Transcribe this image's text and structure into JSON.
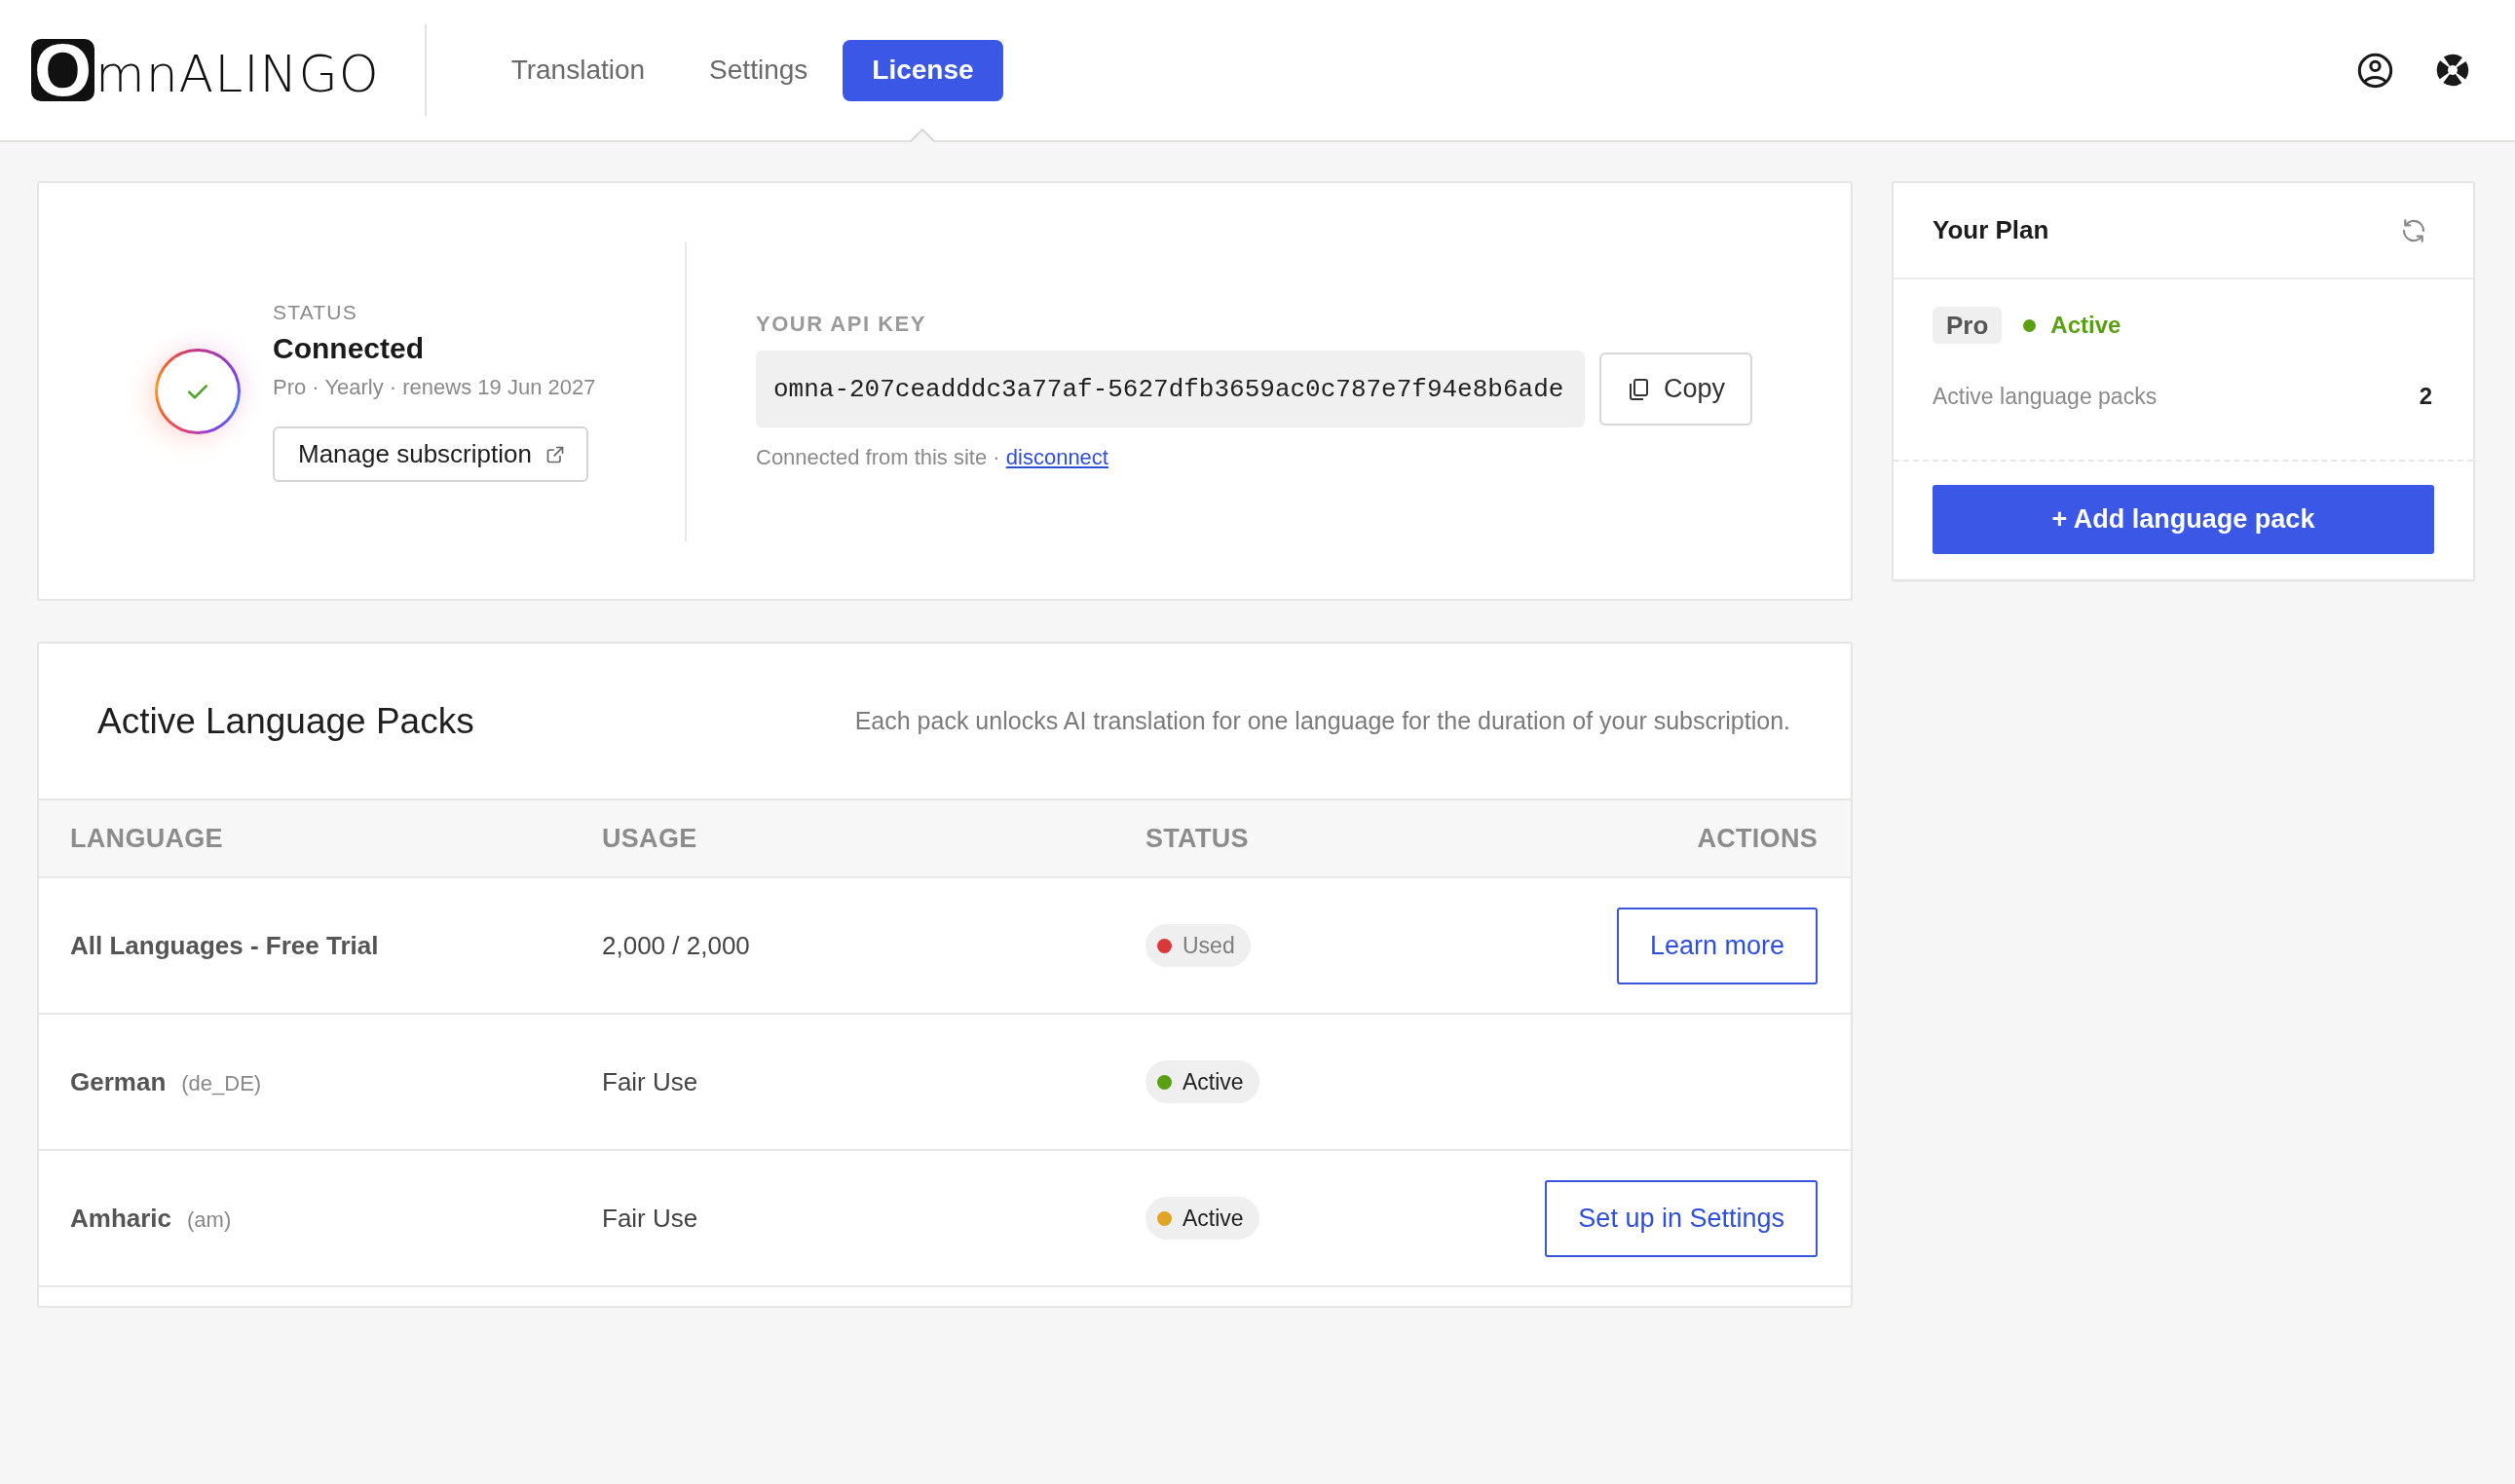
{
  "header": {
    "logo": {
      "mark": "O",
      "text": "mnALINGO"
    },
    "tabs": [
      {
        "label": "Translation",
        "selected": false
      },
      {
        "label": "Settings",
        "selected": false
      },
      {
        "label": "License",
        "selected": true
      }
    ]
  },
  "connection": {
    "status_label": "STATUS",
    "status": "Connected",
    "plan_line": "Pro · Yearly · renews 19 Jun 2027",
    "manage_button": "Manage subscription",
    "api_key_label": "YOUR API KEY",
    "api_key": "omna-207ceadddc3a77af-5627dfb3659ac0c787e7f94e8b6ade",
    "copy_button": "Copy",
    "note": "Connected from this site ·",
    "disconnect_link": "disconnect"
  },
  "plan": {
    "title": "Your Plan",
    "tier": "Pro",
    "status": "Active",
    "stat_label": "Active language packs",
    "stat_value": "2",
    "add_button": "+ Add language pack"
  },
  "packs": {
    "title": "Active Language Packs",
    "description": "Each pack unlocks AI translation for one language for the duration of your subscription.",
    "columns": [
      "LANGUAGE",
      "USAGE",
      "STATUS",
      "ACTIONS"
    ],
    "rows": [
      {
        "language": "All Languages - Free Trial",
        "usage": "2,000 / 2,000",
        "status": {
          "label": "Used",
          "color": "#d83a3a",
          "muted": true
        },
        "action": "Learn more"
      },
      {
        "language": "German",
        "code": "(de_DE)",
        "usage": "Fair Use",
        "status": {
          "label": "Active",
          "color": "#5a9e12",
          "muted": false
        }
      },
      {
        "language": "Amharic",
        "code": "(am)",
        "usage": "Fair Use",
        "status": {
          "label": "Active",
          "color": "#e0a526",
          "muted": false
        },
        "action": "Set up in Settings"
      }
    ]
  }
}
